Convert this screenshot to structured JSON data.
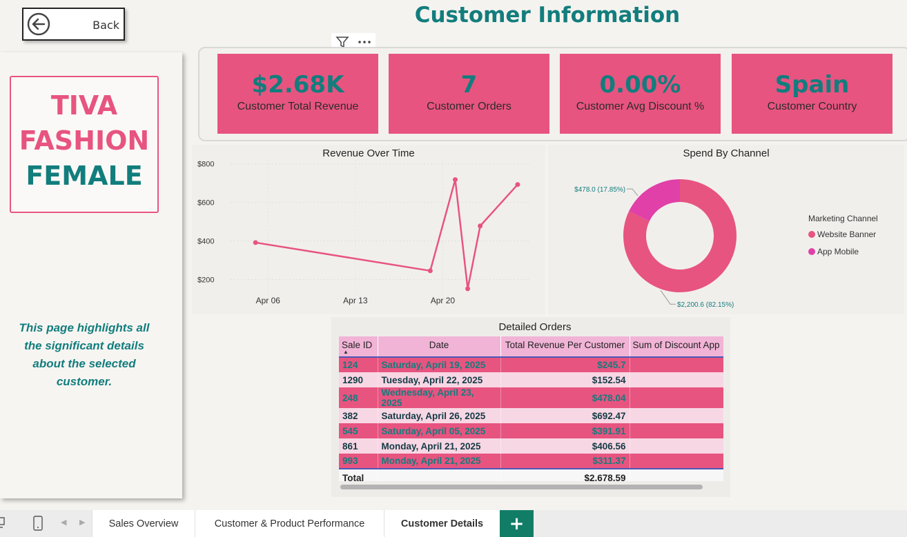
{
  "header": {
    "back_label": "Back",
    "title": "Customer Information"
  },
  "sidebar": {
    "brand_line1": "TIVA",
    "brand_line2": "FASHION",
    "brand_line3": "FEMALE",
    "description": "This page highlights all the significant details about the selected customer."
  },
  "kpis": [
    {
      "value": "$2.68K",
      "label": "Customer Total Revenue"
    },
    {
      "value": "7",
      "label": "Customer Orders"
    },
    {
      "value": "0.00%",
      "label": "Customer Avg Discount %"
    },
    {
      "value": "Spain",
      "label": "Customer Country"
    }
  ],
  "chart_data": [
    {
      "type": "line",
      "title": "Revenue Over Time",
      "xlabel": "",
      "ylabel": "",
      "x_ticks": [
        "Apr 06",
        "Apr 13",
        "Apr 20"
      ],
      "y_ticks": [
        "$200",
        "$400",
        "$600",
        "$800"
      ],
      "ylim": [
        120,
        820
      ],
      "points": [
        {
          "x": "2025-04-05",
          "y": 391.91
        },
        {
          "x": "2025-04-19",
          "y": 245.7
        },
        {
          "x": "2025-04-21",
          "y": 717.93
        },
        {
          "x": "2025-04-22",
          "y": 152.54
        },
        {
          "x": "2025-04-23",
          "y": 478.04
        },
        {
          "x": "2025-04-26",
          "y": 692.47
        }
      ],
      "color": "#e75480",
      "grid": true
    },
    {
      "type": "pie",
      "title": "Spend By Channel",
      "legend_title": "Marketing Channel",
      "legend_position": "right",
      "slices": [
        {
          "label": "Website Banner",
          "value": 2200.6,
          "percent": 82.15,
          "color": "#e75480",
          "data_label": "$2,200.6 (82.15%)"
        },
        {
          "label": "App Mobile",
          "value": 478.0,
          "percent": 17.85,
          "color": "#e040a8",
          "data_label": "$478.0 (17.85%)"
        }
      ]
    }
  ],
  "orders_table": {
    "title": "Detailed Orders",
    "columns": [
      "Sale ID",
      "Date",
      "Total Revenue Per Customer",
      "Sum of Discount App"
    ],
    "rows": [
      {
        "id": "124",
        "date": "Saturday, April 19, 2025",
        "revenue": "$245.7"
      },
      {
        "id": "1290",
        "date": "Tuesday, April 22, 2025",
        "revenue": "$152.54"
      },
      {
        "id": "248",
        "date": "Wednesday, April 23, 2025",
        "revenue": "$478.04"
      },
      {
        "id": "382",
        "date": "Saturday, April 26, 2025",
        "revenue": "$692.47"
      },
      {
        "id": "545",
        "date": "Saturday, April 05, 2025",
        "revenue": "$391.91"
      },
      {
        "id": "861",
        "date": "Monday, April 21, 2025",
        "revenue": "$406.56"
      },
      {
        "id": "993",
        "date": "Monday, April 21, 2025",
        "revenue": "$311.37"
      }
    ],
    "total_label": "Total",
    "total_revenue": "$2,678.59"
  },
  "tabs": [
    {
      "label": "Sales Overview"
    },
    {
      "label": "Customer & Product Performance"
    },
    {
      "label": "Customer Details"
    }
  ],
  "tab_add_label": "+",
  "colors": {
    "accent_pink": "#e75480",
    "accent_teal": "#127d7d",
    "magenta": "#e040a8"
  }
}
